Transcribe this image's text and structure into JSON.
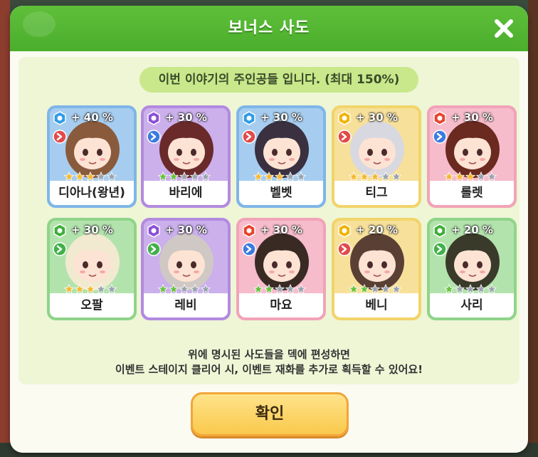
{
  "dialog": {
    "title": "보너스 사도",
    "subtitle": "이번 이야기의 주인공들 입니다. (최대 150%)",
    "info_line1": "위에 명시된 사도들을 덱에 편성하면",
    "info_line2": "이벤트 스테이지 클리어 시, 이벤트 재화를 추가로 획득할 수 있어요!",
    "confirm_label": "확인",
    "close_icon": "close-icon"
  },
  "characters": [
    {
      "name": "디아나(왕년)",
      "bonus": "+ 40 %",
      "element": "ice",
      "role": "striker",
      "stars": 3,
      "frame": "blue"
    },
    {
      "name": "바리에",
      "bonus": "+ 30 %",
      "element": "void",
      "role": "ranger",
      "stars": 2,
      "frame": "purple"
    },
    {
      "name": "벨벳",
      "bonus": "+ 30 %",
      "element": "ice",
      "role": "striker",
      "stars": 3,
      "frame": "blue"
    },
    {
      "name": "티그",
      "bonus": "+ 30 %",
      "element": "light",
      "role": "striker",
      "stars": 3,
      "frame": "yellow"
    },
    {
      "name": "롤렛",
      "bonus": "+ 30 %",
      "element": "fire",
      "role": "ranger",
      "stars": 3,
      "frame": "pink"
    },
    {
      "name": "오팔",
      "bonus": "+ 30 %",
      "element": "nature",
      "role": "supporter",
      "stars": 3,
      "frame": "green"
    },
    {
      "name": "레비",
      "bonus": "+ 30 %",
      "element": "void",
      "role": "supporter",
      "stars": 2,
      "frame": "purple"
    },
    {
      "name": "마요",
      "bonus": "+ 30 %",
      "element": "fire",
      "role": "ranger",
      "stars": 2,
      "frame": "pink"
    },
    {
      "name": "베니",
      "bonus": "+ 20 %",
      "element": "light",
      "role": "striker",
      "stars": 2,
      "frame": "yellow"
    },
    {
      "name": "사리",
      "bonus": "+ 20 %",
      "element": "nature",
      "role": "supporter",
      "stars": 1,
      "frame": "green"
    }
  ],
  "colors": {
    "header_green": "#4aae2c",
    "star_gold": "#f5b82e",
    "star_grey": "#9aa3ad"
  }
}
